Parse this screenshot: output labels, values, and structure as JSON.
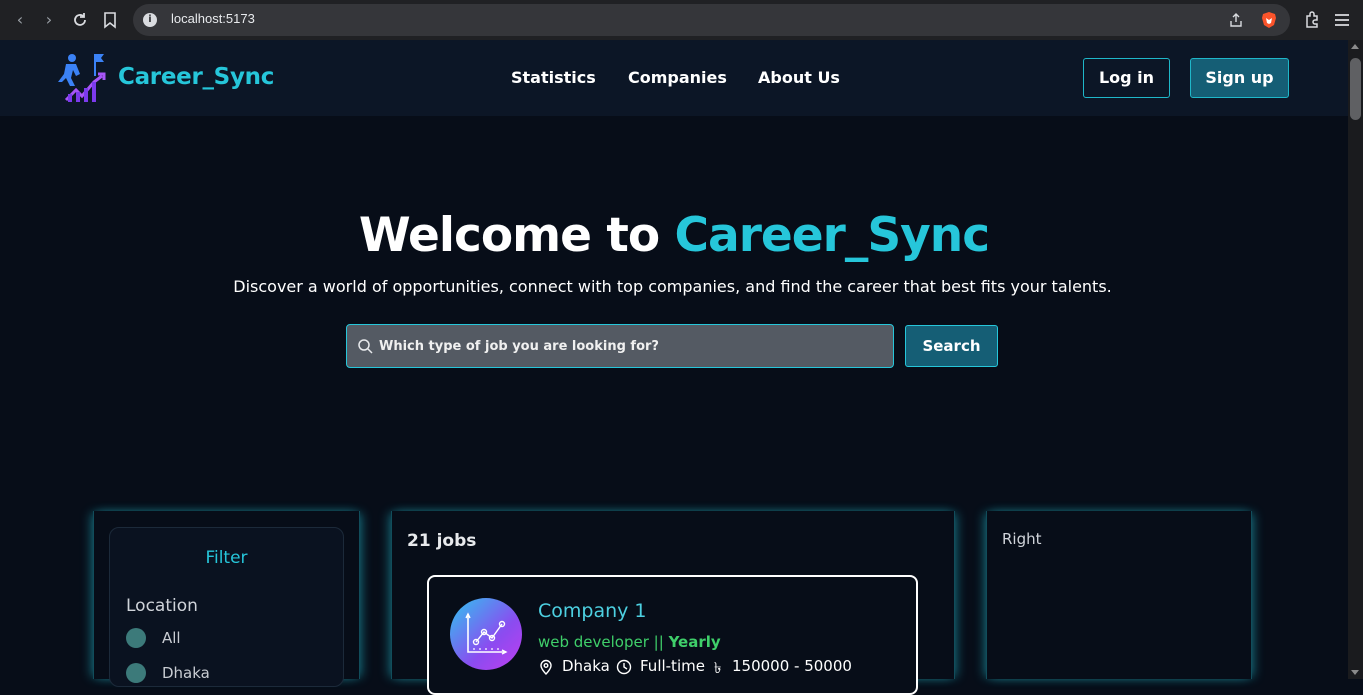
{
  "browser": {
    "url": "localhost:5173"
  },
  "header": {
    "logo_text": "Career_Sync",
    "nav": [
      "Statistics",
      "Companies",
      "About Us"
    ],
    "login_label": "Log in",
    "signup_label": "Sign up"
  },
  "hero": {
    "title_prefix": "Welcome to ",
    "title_accent": "Career_Sync",
    "subtitle": "Discover a world of opportunities, connect with top companies, and find the career that best fits your talents.",
    "search_placeholder": "Which type of job you are looking for?",
    "search_button": "Search"
  },
  "filter": {
    "title": "Filter",
    "location_label": "Location",
    "options": [
      "All",
      "Dhaka"
    ]
  },
  "jobs": {
    "count_label": "21 jobs",
    "items": [
      {
        "company": "Company 1",
        "role": "web developer",
        "separator": " || ",
        "period": "Yearly",
        "location": "Dhaka",
        "type": "Full-time",
        "currency_symbol": "৳",
        "salary": "150000 - 50000"
      }
    ]
  },
  "right_panel": {
    "label": "Right"
  },
  "colors": {
    "accent": "#26c6da",
    "button_bg": "#155e75",
    "page_bg": "#070d18",
    "header_bg": "#0c1626",
    "role_green": "#3fcf6a"
  }
}
